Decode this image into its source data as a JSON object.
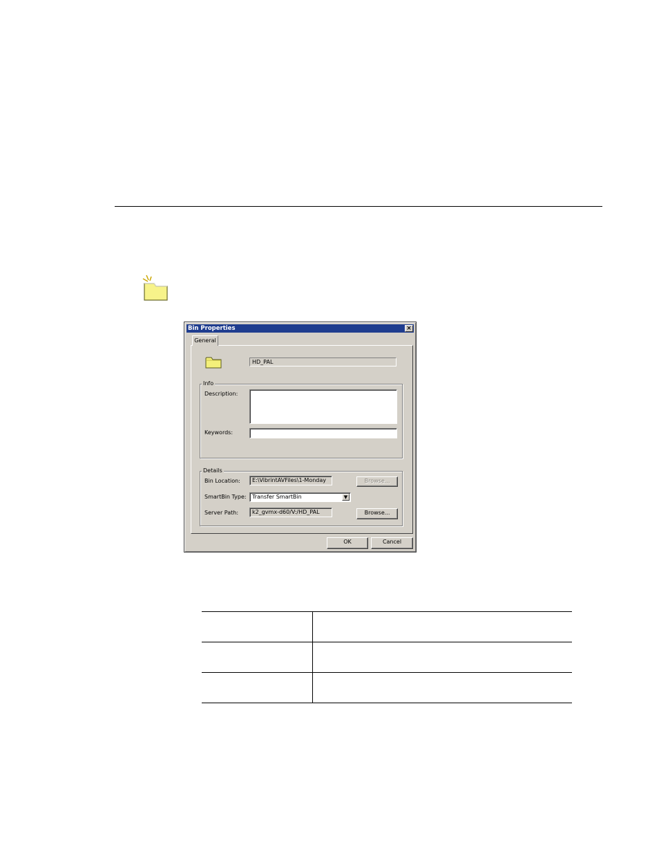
{
  "dialog": {
    "title": "Bin Properties",
    "close_glyph": "×",
    "tab_label": "General",
    "bin_name": "HD_PAL",
    "info": {
      "group_label": "Info",
      "description_label": "Description:",
      "description_value": "",
      "keywords_label": "Keywords:",
      "keywords_value": ""
    },
    "details": {
      "group_label": "Details",
      "bin_location_label": "Bin Location:",
      "bin_location_value": "E:\\VibrintAVFiles\\1-Monday",
      "browse_disabled_label": "Browse...",
      "smartbin_type_label": "SmartBin Type:",
      "smartbin_type_value": "Transfer SmartBin",
      "server_path_label": "Server Path:",
      "server_path_value": "k2_gvmx-d60/V:/HD_PAL",
      "browse_label": "Browse..."
    },
    "ok_label": "OK",
    "cancel_label": "Cancel",
    "dropdown_arrow": "▼"
  },
  "table": {
    "rows": [
      {
        "col1": "",
        "col2": ""
      },
      {
        "col1": "",
        "col2": ""
      },
      {
        "col1": "",
        "col2": ""
      }
    ]
  },
  "colors": {
    "titlebar": "#1f3d8f",
    "dialog_face": "#d4d0c8",
    "folder_yellow": "#f4f07a"
  },
  "icons": {
    "page_icon": "new-bin-icon",
    "dialog_icon": "folder-icon"
  }
}
